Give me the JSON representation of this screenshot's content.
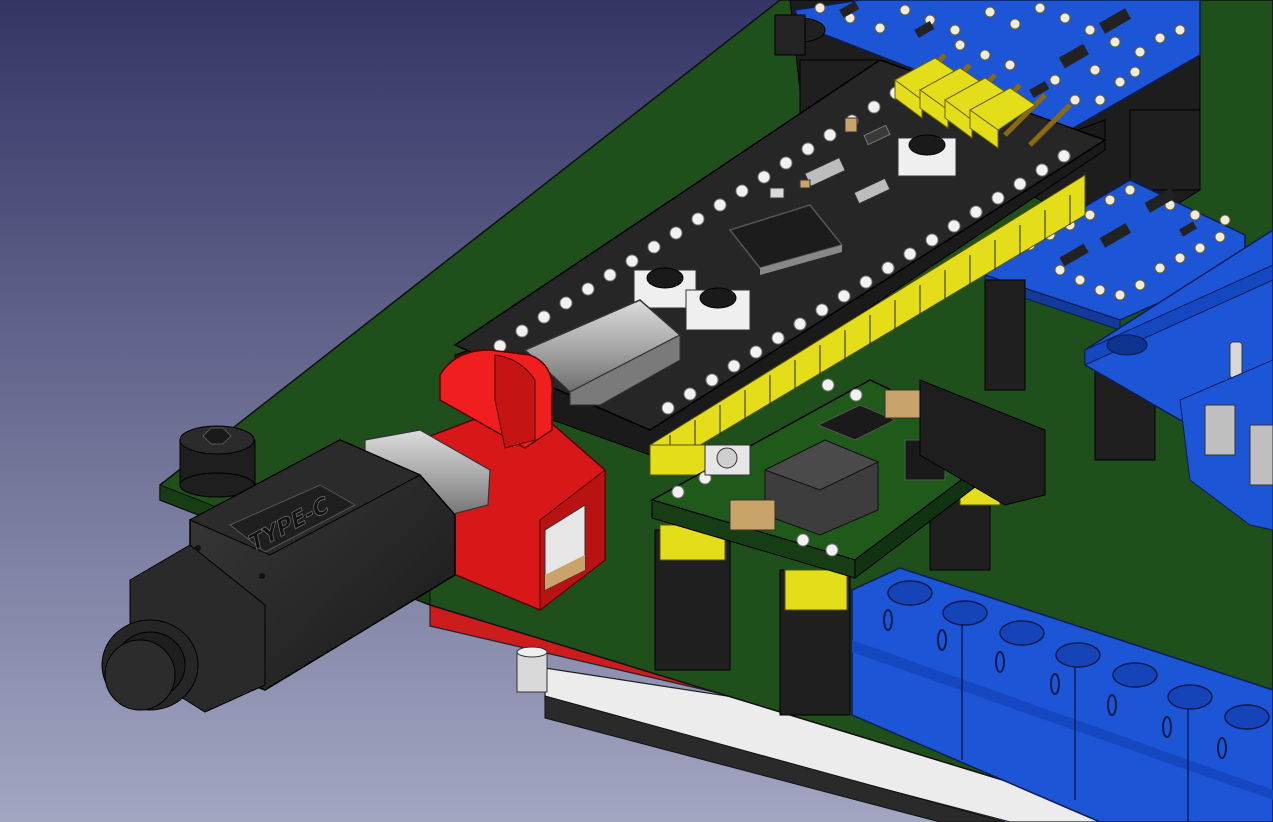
{
  "scene": {
    "background_top_color": "#343565",
    "background_bottom_color": "#a2a6c1",
    "pcb_green": "#1f4f1a",
    "mcu_board_black": "#262626",
    "terminal_blue": "#1c55d6",
    "usb_holder_red": "#e51414",
    "pin_header_yellow": "#e3dd1a"
  },
  "usb_plug": {
    "label": "TYPE-C"
  }
}
